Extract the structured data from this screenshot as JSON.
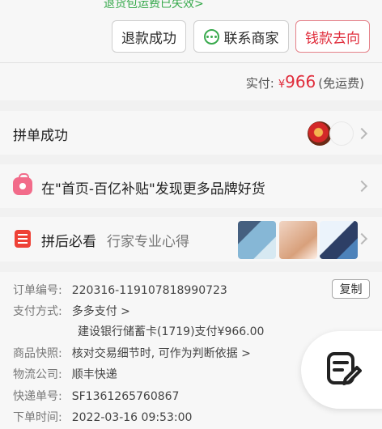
{
  "header": {
    "notice": "退货包运费已失效>",
    "refund_button": "退款成功",
    "contact_button": "联系商家",
    "money_button": "钱款去向",
    "paid_label": "实付:",
    "currency": "¥",
    "paid_amount": "966",
    "paid_note": "(免运费)"
  },
  "group": {
    "title": "拼单成功"
  },
  "promo": {
    "text": "在\"首页-百亿补贴\"发现更多品牌好货"
  },
  "must_see": {
    "title": "拼后必看",
    "subtitle": "行家专业心得"
  },
  "order": {
    "number_label": "订单编号:",
    "number": "220316-119107818990723",
    "copy_button": "复制",
    "payment_label": "支付方式:",
    "payment_method": "多多支付 >",
    "payment_detail": "建设银行储蓄卡(1719)支付¥966.00",
    "snapshot_label": "商品快照:",
    "snapshot_text": "核对交易细节时, 可作为判断依据 >",
    "logistics_label": "物流公司:",
    "logistics_company": "顺丰快递",
    "tracking_label": "快递单号:",
    "tracking_number": "SF1361265760867",
    "time_label": "下单时间:",
    "order_time": "2022-03-16 09:53:00"
  },
  "icons": {
    "chat": "chat-bubble-icon",
    "bag": "shopping-bag-icon",
    "list": "note-list-icon",
    "edit": "edit-note-icon"
  },
  "colors": {
    "accent": "#e02d3c",
    "green": "#3aaa4e",
    "pink": "#f26b8a"
  }
}
